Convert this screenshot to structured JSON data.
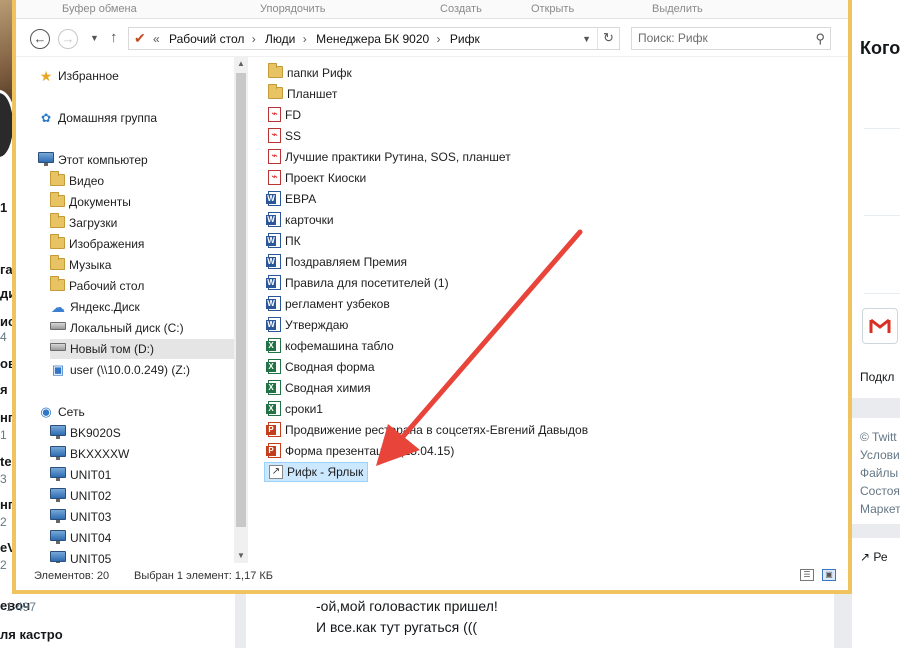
{
  "colors": {
    "window_frame": "#f0c35f",
    "selection_bg": "#cce8ff",
    "arrow": "#e8443a"
  },
  "ribbon": {
    "groups": [
      "Буфер обмена",
      "Упорядочить",
      "Создать",
      "Открыть",
      "Выделить"
    ]
  },
  "address_bar": {
    "prefix": "«",
    "crumbs": [
      "Рабочий стол",
      "Люди",
      "Менеджера БК 9020",
      "Рифк"
    ],
    "search_placeholder": "Поиск: Рифк"
  },
  "nav_pane": {
    "favorites": "Избранное",
    "homegroup": "Домашняя группа",
    "this_pc": "Этот компьютер",
    "pc_items": [
      {
        "label": "Видео",
        "icon": "folder-icon"
      },
      {
        "label": "Документы",
        "icon": "folder-icon"
      },
      {
        "label": "Загрузки",
        "icon": "folder-icon"
      },
      {
        "label": "Изображения",
        "icon": "folder-icon"
      },
      {
        "label": "Музыка",
        "icon": "folder-icon"
      },
      {
        "label": "Рабочий стол",
        "icon": "folder-icon"
      },
      {
        "label": "Яндекс.Диск",
        "icon": "cloud-icon"
      },
      {
        "label": "Локальный диск (C:)",
        "icon": "drive-icon"
      },
      {
        "label": "Новый том (D:)",
        "icon": "drive-icon"
      },
      {
        "label": "user (\\\\10.0.0.249) (Z:)",
        "icon": "network-drive-icon"
      }
    ],
    "network": "Сеть",
    "network_items": [
      "BK9020S",
      "BKXXXXW",
      "UNIT01",
      "UNIT02",
      "UNIT03",
      "UNIT04",
      "UNIT05"
    ]
  },
  "files": [
    {
      "name": "папки Рифк",
      "type": "folder"
    },
    {
      "name": "Планшет",
      "type": "folder"
    },
    {
      "name": "FD",
      "type": "pdf"
    },
    {
      "name": "SS",
      "type": "pdf"
    },
    {
      "name": "Лучшие практики Рутина, SOS, планшет",
      "type": "pdf"
    },
    {
      "name": "Проект Киоски",
      "type": "pdf"
    },
    {
      "name": "ЕВРА",
      "type": "word"
    },
    {
      "name": "карточки",
      "type": "word"
    },
    {
      "name": "ПК",
      "type": "word"
    },
    {
      "name": "Поздравляем Премия",
      "type": "word"
    },
    {
      "name": "Правила для посетителей (1)",
      "type": "word"
    },
    {
      "name": "регламент узбеков",
      "type": "word"
    },
    {
      "name": "Утверждаю",
      "type": "word"
    },
    {
      "name": "кофемашина табло",
      "type": "excel"
    },
    {
      "name": "Сводная форма",
      "type": "excel"
    },
    {
      "name": "Сводная химия",
      "type": "excel"
    },
    {
      "name": "сроки1",
      "type": "excel"
    },
    {
      "name": "Продвижение ресторана в соцсетях-Евгений Давыдов",
      "type": "powerpoint"
    },
    {
      "name": "Форма презентации (15.04.15)",
      "type": "powerpoint"
    },
    {
      "name": "Рифк - Ярлык",
      "type": "shortcut",
      "selected": true
    }
  ],
  "status": {
    "count": "Элементов: 20",
    "selection": "Выбран 1 элемент: 1,17 КБ"
  },
  "background": {
    "right_title": "Кого",
    "right_items": [
      "Подкл",
      "© Twitt",
      "Услови",
      "Файлы",
      "Состоя",
      "Маркет",
      "Ре"
    ],
    "left_fragments": [
      "1",
      "га",
      "ди",
      "ис",
      "ов",
      "я",
      "нг",
      "te",
      "нг",
      "eV",
      "евоч"
    ],
    "left_sub": [
      "4",
      "1",
      "1 497",
      "3",
      "2",
      "2"
    ],
    "bottom_left": [
      "1 497",
      "ля кастро"
    ],
    "tweet_lines": [
      "-ой,мой головастик пришел!",
      "И все.как тут ругаться ((("
    ]
  }
}
